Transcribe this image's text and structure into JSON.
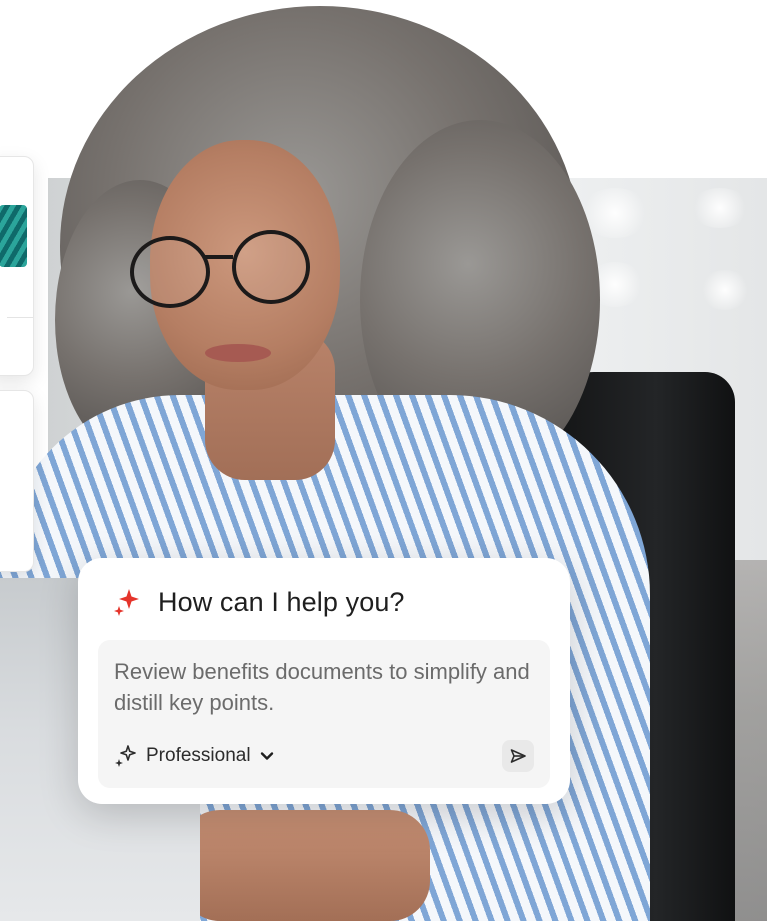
{
  "assistant": {
    "title": "How can I help you?",
    "prompt_text": "Review benefits documents to simplify and distill key points.",
    "tone_label": "Professional",
    "title_icon": "sparkle-icon",
    "tone_icon": "sparkles-icon",
    "tone_dropdown_icon": "chevron-down-icon",
    "send_icon": "send-icon"
  },
  "colors": {
    "accent": "#e5342b",
    "card_background": "#ffffff",
    "prompt_background": "#f5f5f5",
    "title_text": "#1f1f1f",
    "prompt_text": "#6b6b6b"
  }
}
